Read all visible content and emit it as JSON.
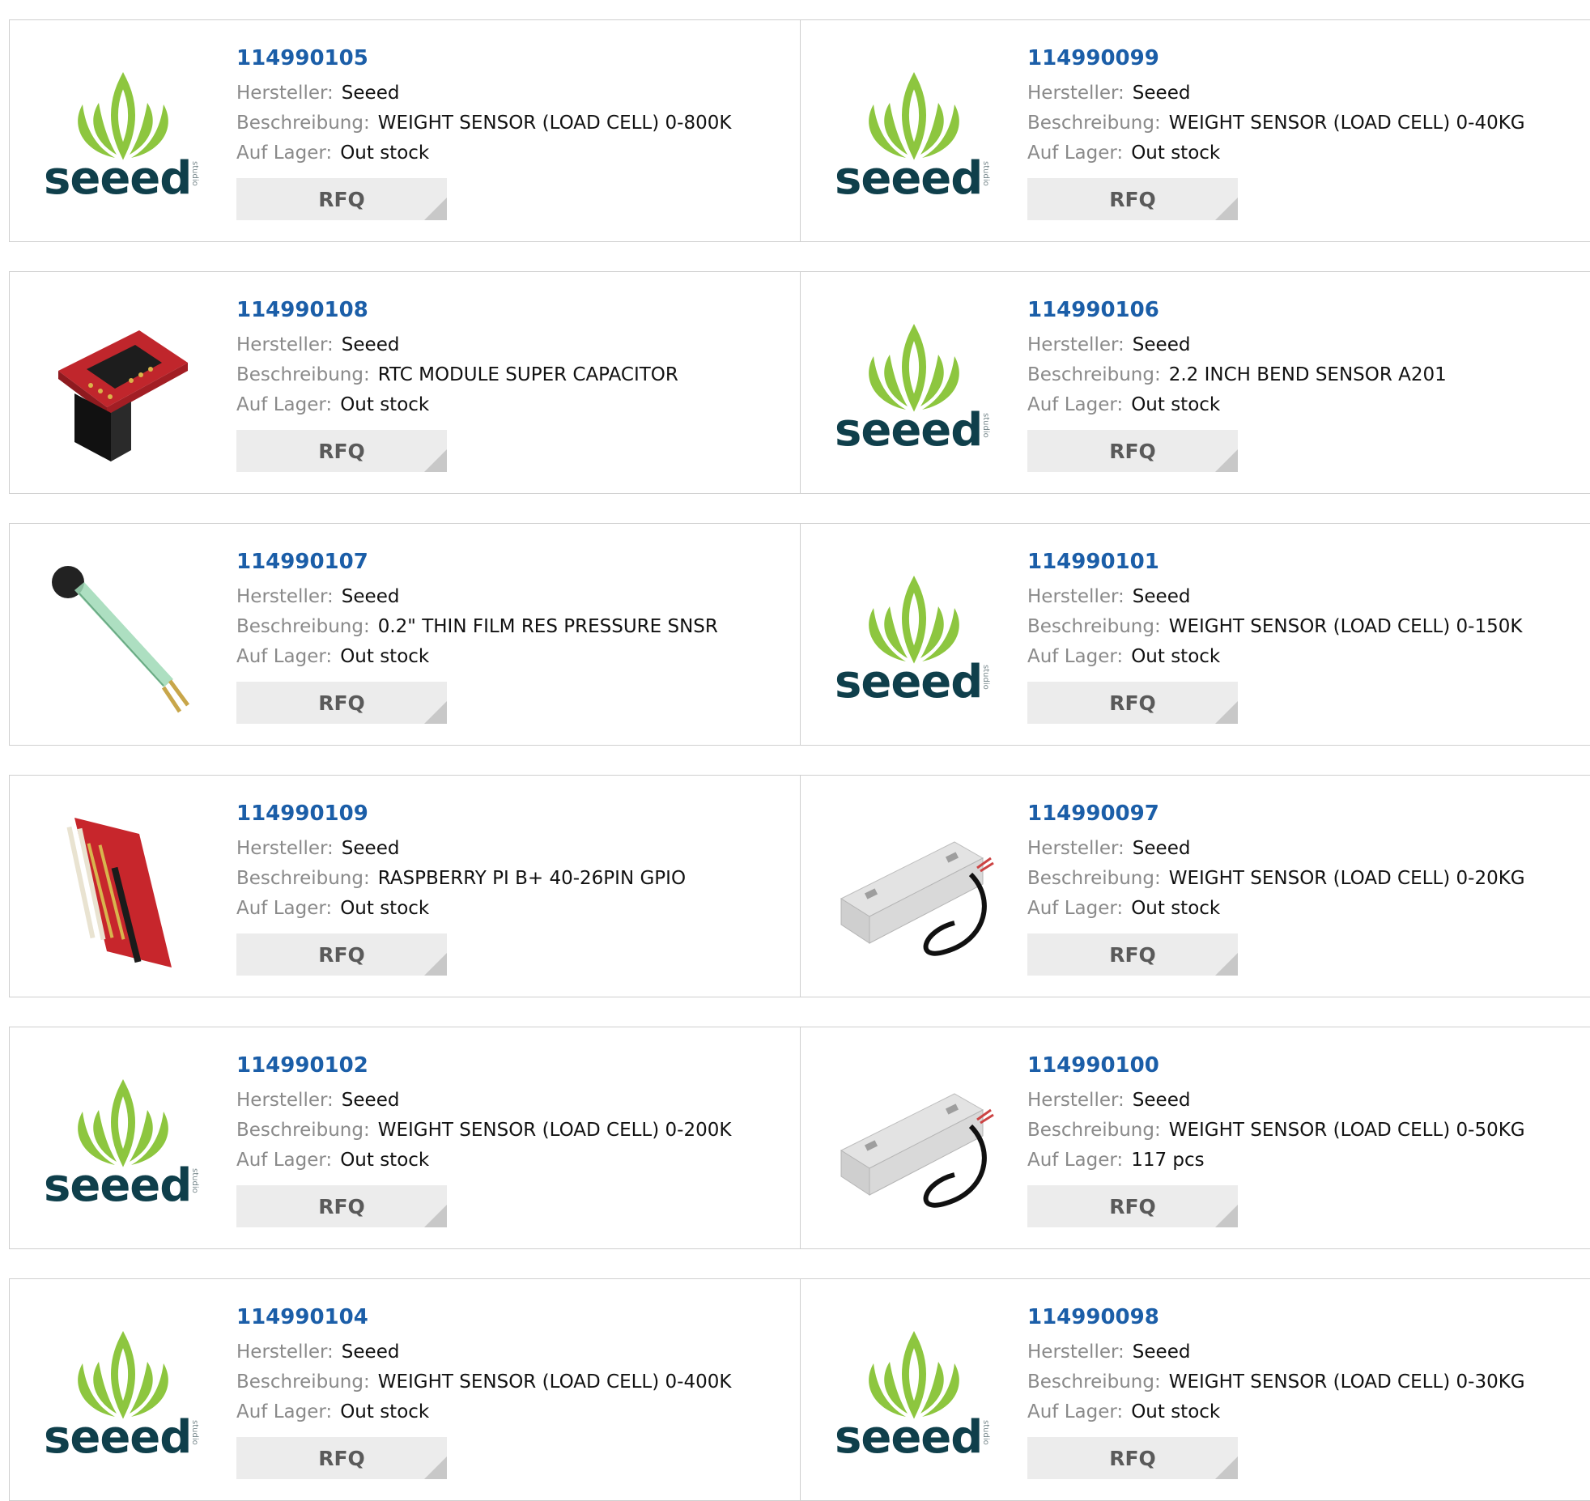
{
  "labels": {
    "manufacturer": "Hersteller:",
    "description": "Beschreibung:",
    "stock": "Auf Lager:",
    "rfq": "RFQ"
  },
  "colors": {
    "part_link": "#1b5ea8",
    "seeed_green": "#8dc63f",
    "seeed_dark": "#0f3f4b",
    "border": "#cfcfcf"
  },
  "products": [
    {
      "part": "114990105",
      "manufacturer": "Seeed",
      "description": "WEIGHT SENSOR (LOAD CELL) 0-800K",
      "stock": "Out stock",
      "image": "seeed-logo"
    },
    {
      "part": "114990099",
      "manufacturer": "Seeed",
      "description": "WEIGHT SENSOR (LOAD CELL) 0-40KG",
      "stock": "Out stock",
      "image": "seeed-logo"
    },
    {
      "part": "114990108",
      "manufacturer": "Seeed",
      "description": "RTC MODULE SUPER CAPACITOR",
      "stock": "Out stock",
      "image": "rtc-module"
    },
    {
      "part": "114990106",
      "manufacturer": "Seeed",
      "description": "2.2 INCH BEND SENSOR A201",
      "stock": "Out stock",
      "image": "seeed-logo"
    },
    {
      "part": "114990107",
      "manufacturer": "Seeed",
      "description": "0.2\" THIN FILM RES PRESSURE SNSR",
      "stock": "Out stock",
      "image": "pressure-sensor"
    },
    {
      "part": "114990101",
      "manufacturer": "Seeed",
      "description": "WEIGHT SENSOR (LOAD CELL) 0-150K",
      "stock": "Out stock",
      "image": "seeed-logo"
    },
    {
      "part": "114990109",
      "manufacturer": "Seeed",
      "description": "RASPBERRY PI B+ 40-26PIN GPIO",
      "stock": "Out stock",
      "image": "gpio-adapter"
    },
    {
      "part": "114990097",
      "manufacturer": "Seeed",
      "description": "WEIGHT SENSOR (LOAD CELL) 0-20KG",
      "stock": "Out stock",
      "image": "load-cell"
    },
    {
      "part": "114990102",
      "manufacturer": "Seeed",
      "description": "WEIGHT SENSOR (LOAD CELL) 0-200K",
      "stock": "Out stock",
      "image": "seeed-logo"
    },
    {
      "part": "114990100",
      "manufacturer": "Seeed",
      "description": "WEIGHT SENSOR (LOAD CELL) 0-50KG",
      "stock": "117 pcs",
      "image": "load-cell"
    },
    {
      "part": "114990104",
      "manufacturer": "Seeed",
      "description": "WEIGHT SENSOR (LOAD CELL) 0-400K",
      "stock": "Out stock",
      "image": "seeed-logo"
    },
    {
      "part": "114990098",
      "manufacturer": "Seeed",
      "description": "WEIGHT SENSOR (LOAD CELL) 0-30KG",
      "stock": "Out stock",
      "image": "seeed-logo"
    }
  ]
}
